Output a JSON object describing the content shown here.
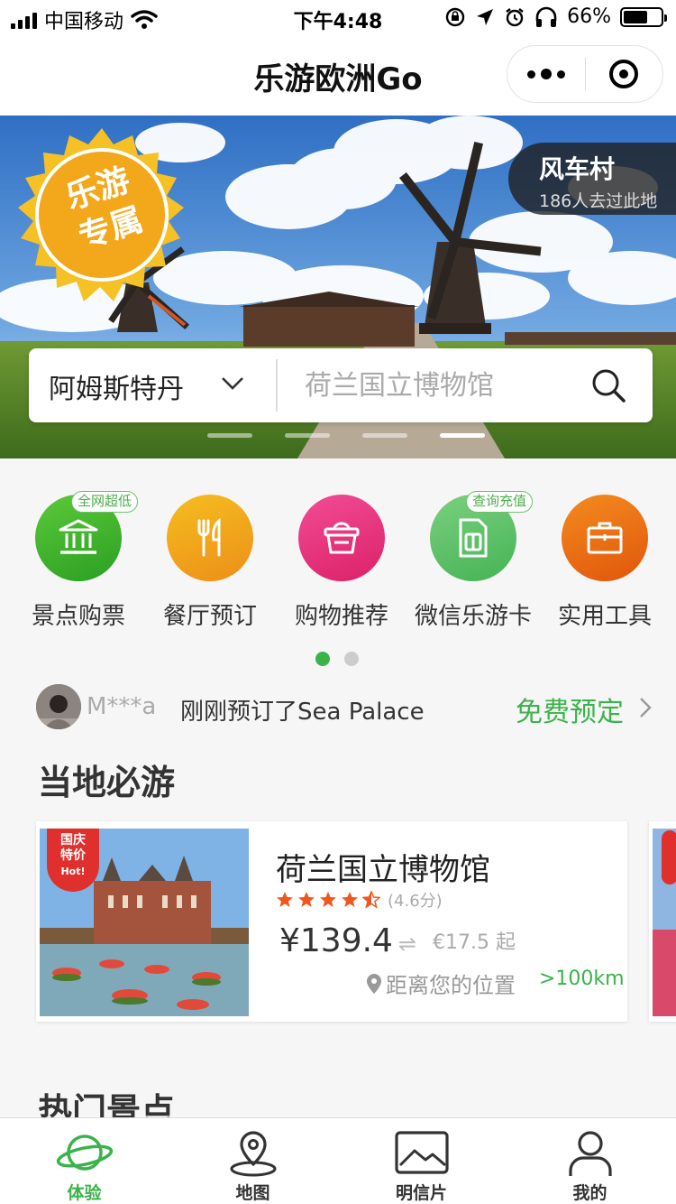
{
  "status_bar": {
    "carrier": "中国移动",
    "time": "下午4:48",
    "battery": "66%"
  },
  "nav": {
    "title": "乐游欧洲Go"
  },
  "banner": {
    "badge_line1": "乐游",
    "badge_line2": "专属",
    "place_name": "风车村",
    "place_visits": "186人去过此地",
    "city": "阿姆斯特丹",
    "search_placeholder": "荷兰国立博物馆",
    "slide_count": 4,
    "active_slide": 4
  },
  "categories": [
    {
      "label": "景点购票",
      "tag": "全网超低",
      "icon": "museum-icon",
      "color": "#3ab32f"
    },
    {
      "label": "餐厅预订",
      "tag": "",
      "icon": "fork-knife-icon",
      "color": "#f0a21b"
    },
    {
      "label": "购物推荐",
      "tag": "",
      "icon": "basket-icon",
      "color": "#e8337a"
    },
    {
      "label": "微信乐游卡",
      "tag": "查询充值",
      "icon": "sim-card-icon",
      "color": "#5cc06a"
    },
    {
      "label": "实用工具",
      "tag": "",
      "icon": "toolbox-icon",
      "color": "#ee6e12"
    }
  ],
  "category_pages": {
    "count": 2,
    "active": 1
  },
  "ticker": {
    "user": "M***a",
    "message": "刚刚预订了Sea Palace",
    "action": "免费预定"
  },
  "sections": {
    "must_visit": "当地必游",
    "popular": "热门景点"
  },
  "attraction": {
    "promo_line1": "国庆",
    "promo_line2": "特价",
    "promo_hot": "Hot!",
    "name": "荷兰国立博物馆",
    "rating": 4.6,
    "rating_text": "(4.6分)",
    "price_cny": "¥139.4",
    "price_eur": "€17.5 起",
    "distance_label": "距离您的位置",
    "distance_value": ">100km"
  },
  "tabs": [
    {
      "label": "体验",
      "icon": "planet-icon",
      "active": true
    },
    {
      "label": "地图",
      "icon": "map-pin-icon",
      "active": false
    },
    {
      "label": "明信片",
      "icon": "postcard-icon",
      "active": false
    },
    {
      "label": "我的",
      "icon": "person-icon",
      "active": false
    }
  ],
  "colors": {
    "brand_green": "#3cb34a",
    "promo_red": "#e0302d",
    "star_orange": "#f0571f"
  }
}
